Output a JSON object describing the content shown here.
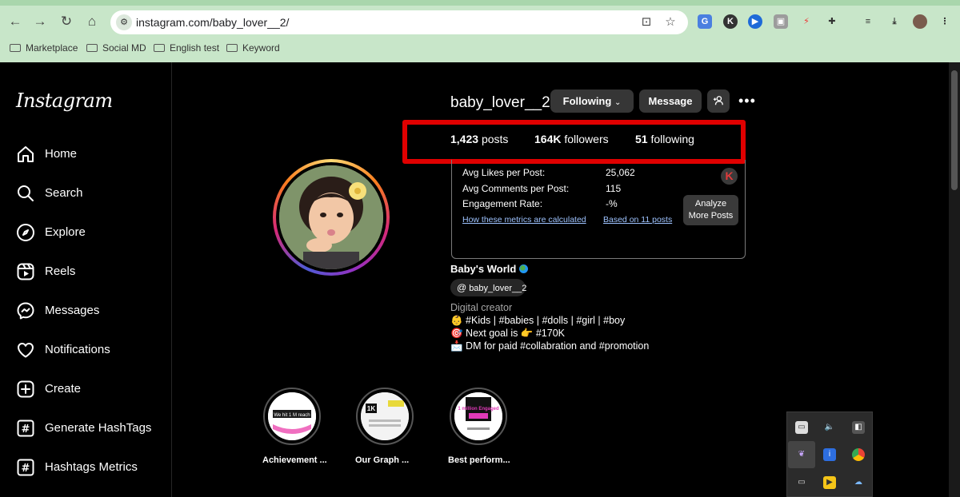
{
  "browser": {
    "url": "instagram.com/baby_lover__2/",
    "bookmarks": [
      "Marketplace",
      "Social MD",
      "English test",
      "Keyword"
    ],
    "extension_labels": [
      "K"
    ]
  },
  "sidebar": {
    "logo": "Instagram",
    "items": [
      {
        "label": "Home",
        "icon": "home-icon"
      },
      {
        "label": "Search",
        "icon": "search-icon"
      },
      {
        "label": "Explore",
        "icon": "compass-icon"
      },
      {
        "label": "Reels",
        "icon": "reels-icon"
      },
      {
        "label": "Messages",
        "icon": "messenger-icon"
      },
      {
        "label": "Notifications",
        "icon": "heart-icon"
      },
      {
        "label": "Create",
        "icon": "plus-square-icon"
      },
      {
        "label": "Generate HashTags",
        "icon": "hashtag-icon"
      },
      {
        "label": "Hashtags Metrics",
        "icon": "hashtag-icon"
      }
    ]
  },
  "profile": {
    "username": "baby_lover__2",
    "following_button": "Following",
    "message_button": "Message",
    "stats": {
      "posts_count": "1,423",
      "posts_label": "posts",
      "followers_count": "164K",
      "followers_label": "followers",
      "following_count": "51",
      "following_label": "following"
    },
    "full_name": "Baby's World",
    "threads_handle": "baby_lover__2",
    "category": "Digital creator",
    "bio": [
      "👶 #Kids | #babies | #dolls | #girl | #boy",
      "🎯 Next goal is 👉 #170K",
      "📩 DM for paid #collabration and #promotion"
    ]
  },
  "metrics": {
    "avg_likes_label": "Avg Likes per Post:",
    "avg_likes_value": "25,062",
    "avg_comments_label": "Avg Comments per Post:",
    "avg_comments_value": "115",
    "engagement_label": "Engagement Rate:",
    "engagement_value": "-%",
    "how_link": "How these metrics are calculated",
    "based_link": "Based on 11 posts",
    "badge": "K",
    "analyze_line1": "Analyze",
    "analyze_line2": "More Posts"
  },
  "highlights": [
    {
      "label": "Achievement ...",
      "inner_text": "We hit 1 M reach"
    },
    {
      "label": "Our Graph ...",
      "inner_text": "1K"
    },
    {
      "label": "Best perform...",
      "inner_text": "1 million Engaged"
    }
  ],
  "colors": {
    "highlight_box": "#e00000",
    "browser_bg": "#c8e6c9",
    "button_bg": "#363636"
  }
}
